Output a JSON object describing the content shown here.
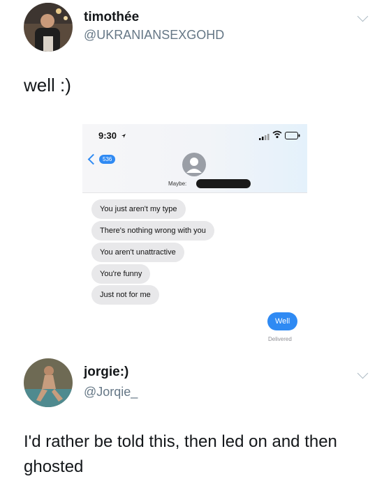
{
  "tweet1": {
    "display_name": "timothée",
    "handle": "@UKRANIANSEXGOHD",
    "text": "well :)"
  },
  "screenshot": {
    "status_time": "9:30",
    "back_badge": "536",
    "contact_name": "Maybe:",
    "messages_received": [
      "You just aren't my type",
      "There's nothing wrong with you",
      "You aren't unattractive",
      "You're funny",
      "Just not for me"
    ],
    "message_sent": "Well",
    "delivered_label": "Delivered",
    "colors": {
      "sent_bubble": "#2f8af3",
      "received_bubble": "#e8e8ea"
    }
  },
  "tweet2": {
    "display_name": "jorgie:)",
    "handle": "@Jorqie_",
    "text": "I'd rather be told this, then led on and then ghosted"
  }
}
